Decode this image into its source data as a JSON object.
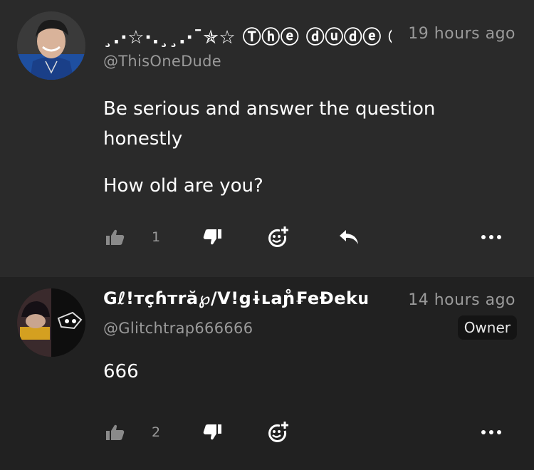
{
  "comments": [
    {
      "author": "¸.·☆·.¸¸.·¯✯☆ Ⓣⓗⓔ ⓓⓤⓓⓔ ⓦ",
      "time": "19 hours ago",
      "handle": "@ThisOneDude",
      "body": [
        "Be serious and answer the question honestly",
        "How old are you?"
      ],
      "likes": "1",
      "has_reply": true
    },
    {
      "author": "Gℓ!тçɦтră℘/V!gɨʟaɲ̊₣eĐekս",
      "time": "14 hours ago",
      "handle": "@Glitchtrap666666",
      "badge": "Owner",
      "body": [
        "666"
      ],
      "likes": "2",
      "has_reply": false
    }
  ],
  "icons": {
    "like": "thumbs-up-icon",
    "dislike": "thumbs-down-icon",
    "react": "add-reaction-icon",
    "reply": "reply-icon",
    "more": "more-icon"
  },
  "colors": {
    "bg_primary": "#2a2a2a",
    "bg_secondary": "#212121",
    "text": "#ffffff",
    "muted": "#9a9a9a",
    "badge_bg": "#141414"
  }
}
